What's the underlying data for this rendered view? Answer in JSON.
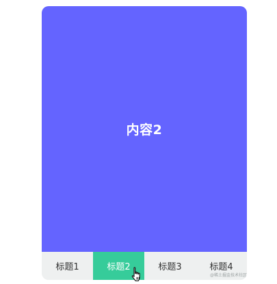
{
  "panel": {
    "content": "内容2",
    "background_color": "#6464ff"
  },
  "tabs": [
    {
      "label": "标题1",
      "active": false
    },
    {
      "label": "标题2",
      "active": true
    },
    {
      "label": "标题3",
      "active": false
    },
    {
      "label": "标题4",
      "active": false
    }
  ],
  "colors": {
    "tab_active_bg": "#36cc9a",
    "tabbar_bg": "#eef0f0"
  },
  "watermark": "@稀土掘金技术社区",
  "cursor": "hand-pointer-icon"
}
